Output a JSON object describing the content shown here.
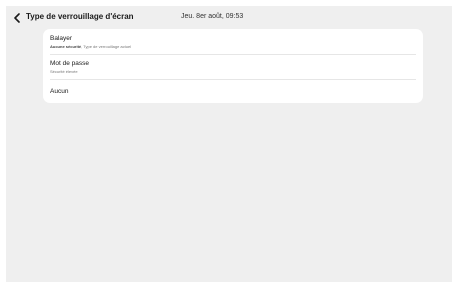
{
  "header": {
    "title": "Type de verrouillage d'écran",
    "datetime": "Jeu. 8er août, 09:53",
    "back_icon": "chevron-left-icon"
  },
  "options": [
    {
      "title": "Balayer",
      "subtitle_strong": "Aucune sécurité",
      "subtitle_rest": ", Type de verrouillage actuel"
    },
    {
      "title": "Mot de passe",
      "subtitle": "Sécurité élevée"
    },
    {
      "title": "Aucun"
    }
  ],
  "colors": {
    "background": "#efefef",
    "card": "#ffffff",
    "text_primary": "#1a1a1a",
    "text_secondary": "#777777"
  }
}
